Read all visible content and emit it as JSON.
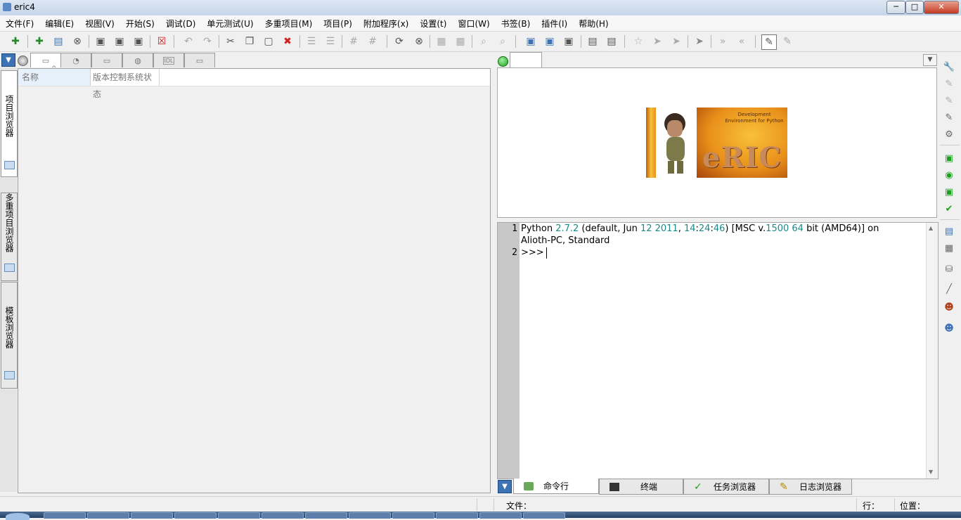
{
  "window": {
    "title": "eric4",
    "minimize": "─",
    "maximize": "□",
    "close": "✕"
  },
  "menu": [
    "文件(F)",
    "编辑(E)",
    "视图(V)",
    "开始(S)",
    "调试(D)",
    "单元测试(U)",
    "多重项目(M)",
    "项目(P)",
    "附加程序(x)",
    "设置(t)",
    "窗口(W)",
    "书签(B)",
    "插件(I)",
    "帮助(H)"
  ],
  "left_vtabs": [
    "项目浏览器",
    "多重项目浏览器",
    "模板浏览器"
  ],
  "left_htab_idl": "IDL",
  "project_tree": {
    "columns": [
      "名称",
      "版本控制系统状态"
    ]
  },
  "splash": {
    "tagline": "Development Environment for Python",
    "logo": "eRIC",
    "colors": {
      "orange": "#e8901a",
      "yellow": "#f9c13a",
      "brown": "#7a3b0d"
    }
  },
  "shell": {
    "line_numbers": [
      "1",
      "2"
    ],
    "banner_segments": [
      {
        "t": "Python ",
        "num": false
      },
      {
        "t": "2.7.2",
        "num": true
      },
      {
        "t": " (default, Jun ",
        "num": false
      },
      {
        "t": "12 2011",
        "num": true
      },
      {
        "t": ", ",
        "num": false
      },
      {
        "t": "14",
        "num": true
      },
      {
        "t": ":",
        "num": false
      },
      {
        "t": "24",
        "num": true
      },
      {
        "t": ":",
        "num": false
      },
      {
        "t": "46",
        "num": true
      },
      {
        "t": ") [MSC v.",
        "num": false
      },
      {
        "t": "1500 64",
        "num": true
      },
      {
        "t": " bit (AMD64)] on",
        "num": false
      }
    ],
    "banner_line2": "Alioth-PC, Standard",
    "prompt": ">>> "
  },
  "bottom_tabs": [
    "命令行",
    "终端",
    "任务浏览器",
    "日志浏览器"
  ],
  "status": {
    "file_label": "文件：",
    "line_label": "行：",
    "pos_label": "位置："
  },
  "colors": {
    "accent": "#3d73b5",
    "number_teal": "#1b8a8a",
    "green_dot": "#1ea21e"
  }
}
